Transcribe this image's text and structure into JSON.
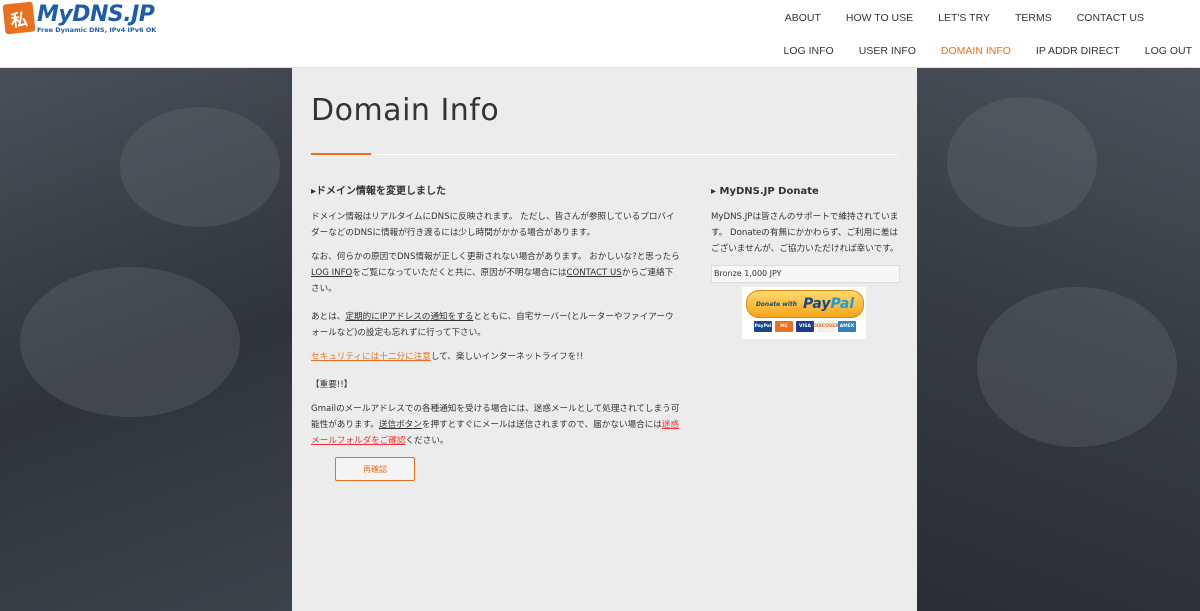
{
  "brand": {
    "title": "MyDNS.JP",
    "tagline": "Free Dynamic DNS, IPv4 IPv6 OK",
    "mark": "私"
  },
  "nav": {
    "row1": [
      "ABOUT",
      "HOW TO USE",
      "LET'S TRY",
      "TERMS",
      "CONTACT US"
    ],
    "row2": [
      "LOG INFO",
      "USER INFO",
      "DOMAIN INFO",
      "IP ADDR DIRECT",
      "LOG OUT"
    ],
    "active": "DOMAIN INFO"
  },
  "page": {
    "title": "Domain Info"
  },
  "notice": {
    "heading": "▸ドメイン情報を変更しました",
    "p1": "ドメイン情報はリアルタイムにDNSに反映されます。 ただし、皆さんが参照しているプロバイダーなどのDNSに情報が行き渡るには少し時間がかかる場合があります。",
    "p2_a": "なお、何らかの原因でDNS情報が正しく更新されない場合があります。 おかしいな?と思ったら",
    "p2_link1": "LOG INFO",
    "p2_b": "をご覧になっていただくと共に、原因が不明な場合には",
    "p2_link2": "CONTACT US",
    "p2_c": "からご連絡下さい。",
    "p3_a": "あとは、",
    "p3_link": "定期的にIPアドレスの通知をする",
    "p3_b": "とともに、自宅サーバー(とルーターやファイアーウォールなど)の設定も忘れずに行って下さい。",
    "p4_link": "セキュリティには十二分に注意",
    "p4_b": "して、楽しいインターネットライフを!!",
    "p5": "【重要!!】",
    "p6_a": "Gmailのメールアドレスでの各種通知を受ける場合には、迷惑メールとして処理されてしまう可能性があります。",
    "p6_link1": "送信ボタン",
    "p6_b": "を押すとすぐにメールは送信されますので、届かない場合には",
    "p6_link2": "迷惑メールフォルダをご確認",
    "p6_c": "ください。",
    "confirm_button": "再確認"
  },
  "donate": {
    "heading": "▸ MyDNS.JP Donate",
    "text": "MyDNS.JPは皆さんのサポートで維持されています。 Donateの有無にかかわらず、ご利用に差はございませんが、ご協力いただければ幸いです。",
    "option": "Bronze 1,000 JPY",
    "paypal_small": "Donate with",
    "paypal_word_a": "Pay",
    "paypal_word_b": "Pal",
    "cards": [
      "PayPal",
      "MC",
      "VISA",
      "DISCOVER",
      "AMEX"
    ]
  }
}
